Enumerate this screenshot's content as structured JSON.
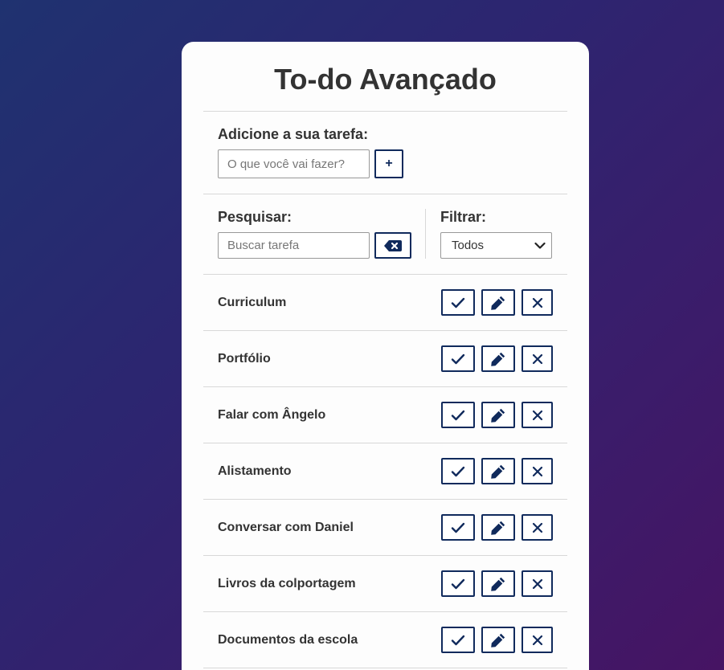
{
  "app": {
    "title": "To-do Avançado"
  },
  "add_form": {
    "label": "Adicione a sua tarefa:",
    "input_placeholder": "O que você vai fazer?",
    "input_value": "",
    "add_button_label": "+"
  },
  "search": {
    "label": "Pesquisar:",
    "input_placeholder": "Buscar tarefa",
    "input_value": "",
    "clear_button_icon": "backspace-icon"
  },
  "filter": {
    "label": "Filtrar:",
    "selected": "Todos"
  },
  "todos": [
    {
      "title": "Curriculum"
    },
    {
      "title": "Portfólio"
    },
    {
      "title": "Falar com Ângelo"
    },
    {
      "title": "Alistamento"
    },
    {
      "title": "Conversar com Daniel"
    },
    {
      "title": "Livros da colportagem"
    },
    {
      "title": "Documentos da escola"
    }
  ],
  "action_icons": {
    "finish": "check-icon",
    "edit": "pen-icon",
    "remove": "xmark-icon"
  },
  "colors": {
    "accent": "#102a5c",
    "card": "#fdfdfd",
    "text": "#333333",
    "background_start": "#1f3270",
    "background_end": "#461463"
  }
}
